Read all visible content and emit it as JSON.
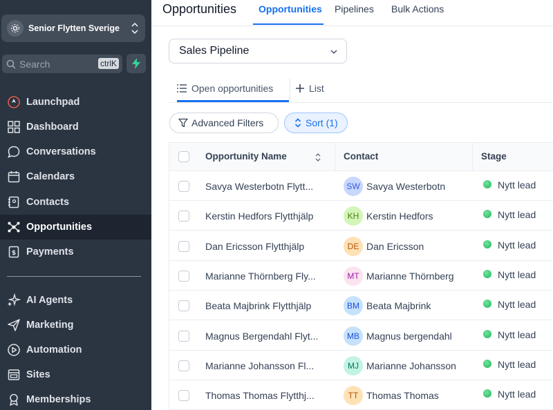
{
  "sidebar": {
    "account_name": "Senior Flytten Sverige",
    "search_placeholder": "Search",
    "search_shortcut": "ctrlK",
    "items": [
      {
        "label": "Launchpad",
        "icon": "rocket-icon"
      },
      {
        "label": "Dashboard",
        "icon": "dashboard-icon"
      },
      {
        "label": "Conversations",
        "icon": "chat-icon"
      },
      {
        "label": "Calendars",
        "icon": "calendar-icon"
      },
      {
        "label": "Contacts",
        "icon": "contacts-icon"
      },
      {
        "label": "Opportunities",
        "icon": "opportunities-icon",
        "active": true
      },
      {
        "label": "Payments",
        "icon": "payments-icon"
      },
      {
        "label": "AI Agents",
        "icon": "sparkle-icon"
      },
      {
        "label": "Marketing",
        "icon": "send-icon"
      },
      {
        "label": "Automation",
        "icon": "automation-icon"
      },
      {
        "label": "Sites",
        "icon": "sites-icon"
      },
      {
        "label": "Memberships",
        "icon": "membership-icon"
      }
    ]
  },
  "header": {
    "title": "Opportunities",
    "tabs": [
      "Opportunities",
      "Pipelines",
      "Bulk Actions"
    ],
    "active_tab": "Opportunities"
  },
  "pipeline": {
    "selected": "Sales Pipeline"
  },
  "subtabs": {
    "open": "Open opportunities",
    "list": "List"
  },
  "filters": {
    "advanced": "Advanced Filters",
    "sort": "Sort (1)"
  },
  "table": {
    "columns": [
      "Opportunity Name",
      "Contact",
      "Stage"
    ],
    "rows": [
      {
        "name": "Savya Westerbotn Flytt...",
        "initials": "SW",
        "contact": "Savya Westerbotn",
        "stage": "Nytt lead",
        "avatar_bg": "#c7d7fe",
        "avatar_fg": "#3b5bdb"
      },
      {
        "name": "Kerstin Hedfors Flytthjälp",
        "initials": "KH",
        "contact": "Kerstin Hedfors",
        "stage": "Nytt lead",
        "avatar_bg": "#d3f5b8",
        "avatar_fg": "#4d7c0f"
      },
      {
        "name": "Dan Ericsson Flytthjälp",
        "initials": "DE",
        "contact": "Dan Ericsson",
        "stage": "Nytt lead",
        "avatar_bg": "#fde2b5",
        "avatar_fg": "#b45309"
      },
      {
        "name": "Marianne Thörnberg Fly...",
        "initials": "MT",
        "contact": "Marianne Thörnberg",
        "stage": "Nytt lead",
        "avatar_bg": "#fbe3f0",
        "avatar_fg": "#a21caf"
      },
      {
        "name": "Beata Majbrink Flytthjälp",
        "initials": "BM",
        "contact": "Beata Majbrink",
        "stage": "Nytt lead",
        "avatar_bg": "#c6e2fb",
        "avatar_fg": "#1d4ed8"
      },
      {
        "name": "Magnus Bergendahl Flyt...",
        "initials": "MB",
        "contact": "Magnus bergendahl",
        "stage": "Nytt lead",
        "avatar_bg": "#c6e2fb",
        "avatar_fg": "#1d4ed8"
      },
      {
        "name": "Marianne Johansson Fl...",
        "initials": "MJ",
        "contact": "Marianne Johansson",
        "stage": "Nytt lead",
        "avatar_bg": "#c3f3e4",
        "avatar_fg": "#047857"
      },
      {
        "name": "Thomas Thomas Flytthj...",
        "initials": "TT",
        "contact": "Thomas Thomas",
        "stage": "Nytt lead",
        "avatar_bg": "#fde2b5",
        "avatar_fg": "#b45309"
      }
    ]
  },
  "colors": {
    "accent": "#1570ef",
    "sidebar_bg": "#2b3441",
    "stage_dot": "#27b061"
  }
}
